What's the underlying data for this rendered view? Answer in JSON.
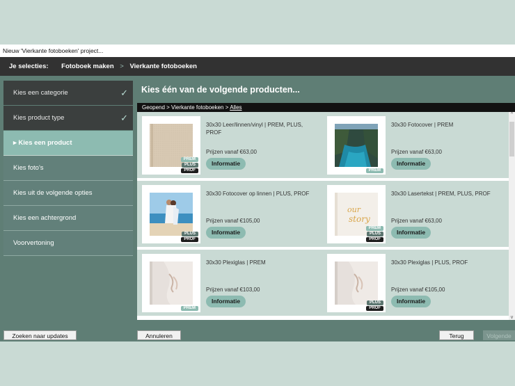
{
  "window": {
    "title": "Nieuw 'Vierkante fotoboeken' project..."
  },
  "selections": {
    "label": "Je selecties:",
    "items": [
      "Fotoboek maken",
      "Vierkante fotoboeken"
    ],
    "separator": ">"
  },
  "sidebar": {
    "items": [
      {
        "label": "Kies een categorie",
        "state": "done"
      },
      {
        "label": "Kies product type",
        "state": "done"
      },
      {
        "label": "▸ Kies een product",
        "state": "active"
      },
      {
        "label": "Kies foto's",
        "state": "todo"
      },
      {
        "label": "Kies uit de volgende opties",
        "state": "todo"
      },
      {
        "label": "Kies een achtergrond",
        "state": "todo"
      },
      {
        "label": "Voorvertoning",
        "state": "todo"
      }
    ],
    "check_icon": "✓"
  },
  "main": {
    "title": "Kies één van de volgende producten...",
    "breadcrumb": {
      "path": "Geopend > Vierkante fotoboeken >",
      "link": "Alles"
    },
    "info_label": "Informatie",
    "products": [
      {
        "name": "30x30 Leer/linnen/vinyl | PREM, PLUS, PROF",
        "price": "Prijzen vanaf €63,00",
        "badges": [
          "PREM",
          "PLUS",
          "PROF"
        ],
        "image": "linen-cover"
      },
      {
        "name": "30x30 Fotocover | PREM",
        "price": "Prijzen vanaf €63,00",
        "badges": [
          "PREM"
        ],
        "image": "lake-photo"
      },
      {
        "name": "30x30 Fotocover op linnen | PLUS, PROF",
        "price": "Prijzen vanaf €105,00",
        "badges": [
          "PLUS",
          "PROF"
        ],
        "image": "couple-beach"
      },
      {
        "name": "30x30 Lasertekst | PREM, PLUS, PROF",
        "price": "Prijzen vanaf €63,00",
        "badges": [
          "PREM",
          "PLUS",
          "PROF"
        ],
        "image": "our-story"
      },
      {
        "name": "30x30 Plexiglas | PREM",
        "price": "Prijzen vanaf €103,00",
        "badges": [
          "PREM"
        ],
        "image": "plexi-hands"
      },
      {
        "name": "30x30 Plexiglas | PLUS, PROF",
        "price": "Prijzen vanaf €105,00",
        "badges": [
          "PLUS",
          "PROF"
        ],
        "image": "plexi-hands"
      }
    ]
  },
  "footer": {
    "update_label": "Zoeken naar updates",
    "cancel_label": "Annuleren",
    "back_label": "Terug",
    "next_label": "Volgende"
  },
  "colors": {
    "accent": "#8dbbb1",
    "dark": "#323232",
    "panel": "#5f7e75",
    "card_bg": "#c9dad4"
  }
}
